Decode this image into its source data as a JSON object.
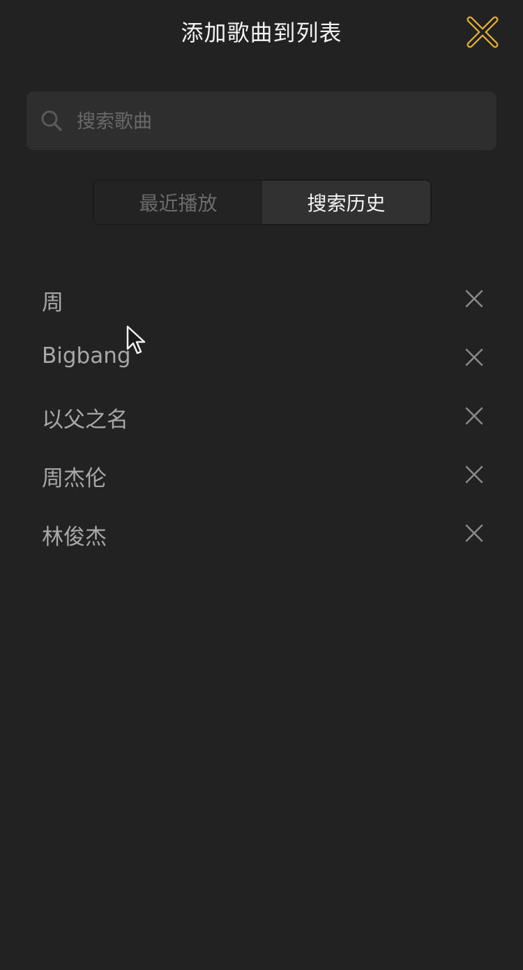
{
  "header": {
    "title": "添加歌曲到列表",
    "close_icon": "close-icon",
    "accent_color": "#e8b23a"
  },
  "search": {
    "placeholder": "搜索歌曲",
    "value": "",
    "icon": "search-icon"
  },
  "tabs": [
    {
      "label": "最近播放",
      "active": false
    },
    {
      "label": "搜索历史",
      "active": true
    }
  ],
  "history": [
    {
      "label": "周"
    },
    {
      "label": "Bigbang"
    },
    {
      "label": "以父之名"
    },
    {
      "label": "周杰伦"
    },
    {
      "label": "林俊杰"
    }
  ],
  "colors": {
    "background": "#222222",
    "search_box": "#2e2e2e",
    "active_tab": "#313131",
    "item_text": "#a8a8a8"
  }
}
